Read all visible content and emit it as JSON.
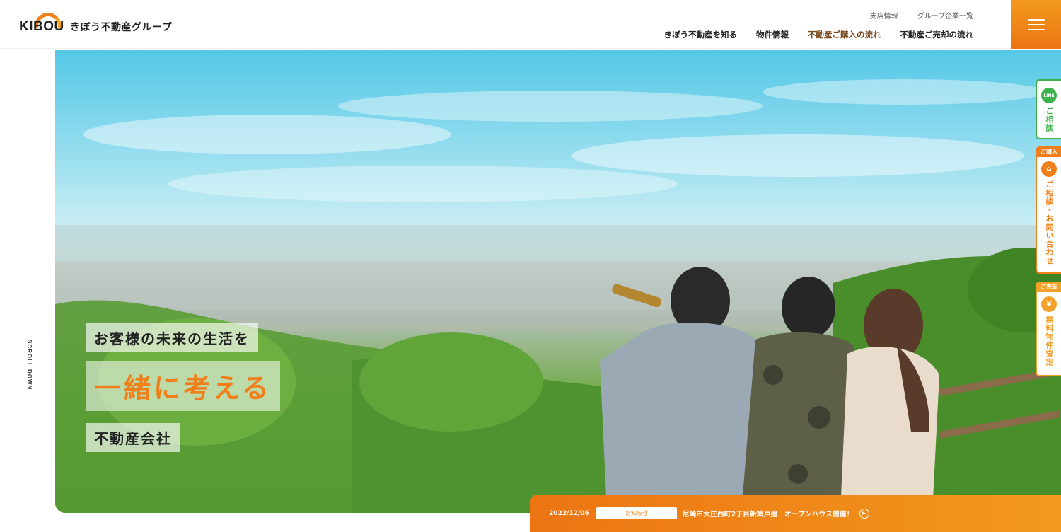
{
  "header": {
    "logo_word": "KIBOU",
    "logo_text": "きぼう不動産グループ",
    "util_nav": [
      "支店情報",
      "グループ企業一覧"
    ],
    "main_nav": [
      {
        "label": "きぼう不動産を知る"
      },
      {
        "label": "物件情報"
      },
      {
        "label": "不動産ご購入の流れ"
      },
      {
        "label": "不動産ご売却の流れ"
      }
    ]
  },
  "colors": {
    "accent": "#f07f1a",
    "accent_light": "#f4a12a",
    "line_green": "#3cb24a"
  },
  "scroll_label": "SCROLL DOWN",
  "hero": {
    "copy_1": "お客様の未来の生活を",
    "copy_2": "一緒に考える",
    "copy_3": "不動産会社"
  },
  "side_tabs": {
    "line": {
      "icon_text": "LINE",
      "label": "ご相談"
    },
    "buy": {
      "head": "ご購入",
      "label": "ご相談・お問い合わせ"
    },
    "sell": {
      "head": "ご売却",
      "label": "無料物件査定"
    }
  },
  "news": {
    "date": "2022/12/06",
    "category": "お知らせ",
    "title": "尼崎市大庄西町2丁目新築戸建　オープンハウス開催！"
  }
}
